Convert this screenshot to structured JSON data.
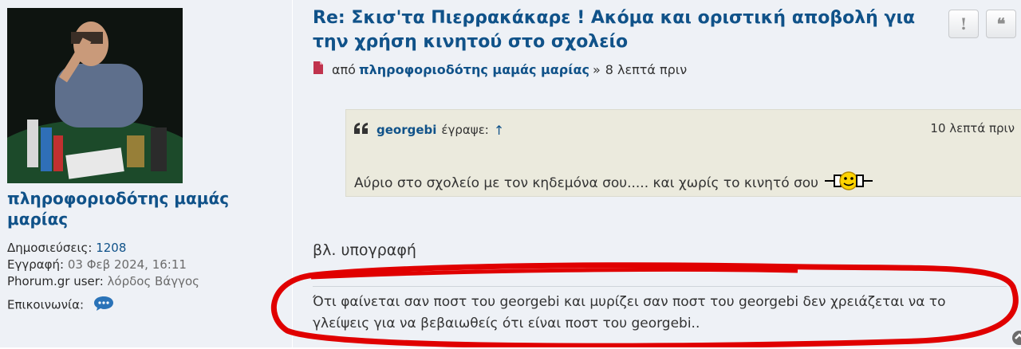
{
  "profile": {
    "username": "πληροφοριοδότης μαμάς μαρίας",
    "posts_label": "Δημοσιεύσεις:",
    "posts_value": "1208",
    "joined_label": "Εγγραφή:",
    "joined_value": "03 Φεβ 2024, 16:11",
    "phorum_label": "Phorum.gr user:",
    "phorum_value": "λόρδος Βάγγος",
    "contact_label": "Επικοινωνία:"
  },
  "post": {
    "title": "Re: Σκισ'τα Πιερρακάκαρε ! Ακόμα και οριστική αποβολή για την χρήση κινητού στο σχολείο",
    "by_label": "από",
    "author": "πληροφοριοδότης μαμάς μαρίας",
    "separator": "»",
    "time": "8 λεπτά πριν",
    "report_label": "!",
    "quote_label": "❝",
    "quote": {
      "author": "georgebi",
      "wrote_label": "έγραψε:",
      "arrow": "↑",
      "time": "10 λεπτά πριν",
      "text": "Αύριο στο σχολείο με τον κηδεμόνα σου..... και χωρίς το κινητό σου"
    },
    "signature_title": "βλ. υπογραφή",
    "signature": "Ότι φαίνεται σαν ποστ του georgebi και μυρίζει σαν ποστ του georgebi δεν χρειάζεται να το γλείψεις για να βεβαιωθείς ότι είναι ποστ του georgebi.."
  },
  "colors": {
    "link": "#105289",
    "post_bg": "#eef1f6",
    "quote_bg": "#ebeadd",
    "annotation": "#e00000"
  },
  "icons": [
    "file-icon",
    "quote-icon",
    "chat-bubble-icon",
    "smiley-icon",
    "top-arrow-icon"
  ]
}
